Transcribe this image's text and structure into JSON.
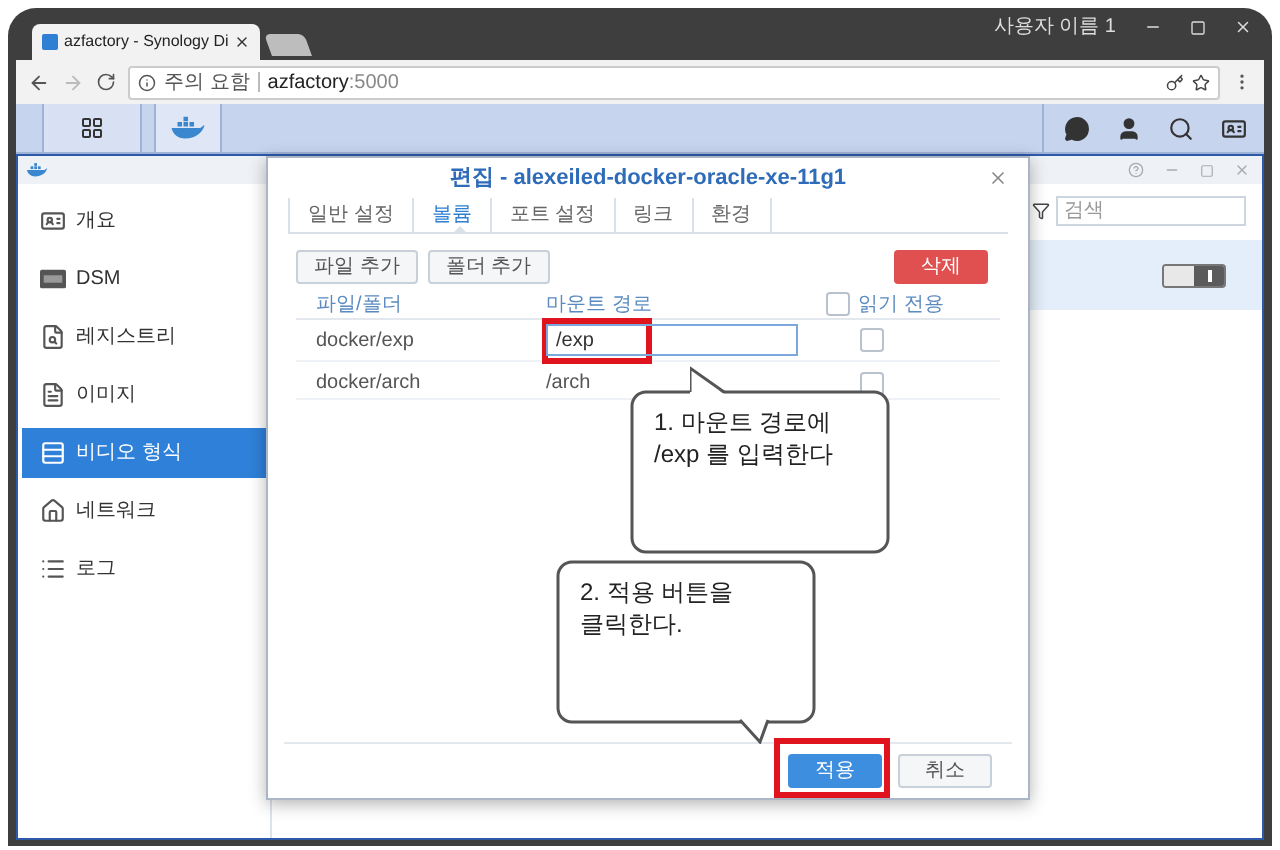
{
  "browser": {
    "tab_title": "azfactory - Synology Di",
    "profile": "사용자 이름 1",
    "security": "주의 요함",
    "url_host": "azfactory",
    "url_port": ":5000"
  },
  "sidebar": {
    "items": [
      {
        "label": "개요",
        "selected": false
      },
      {
        "label": "DSM",
        "selected": false
      },
      {
        "label": "레지스트리",
        "selected": false
      },
      {
        "label": "이미지",
        "selected": false
      },
      {
        "label": "비디오 형식",
        "selected": true
      },
      {
        "label": "네트워크",
        "selected": false
      },
      {
        "label": "로그",
        "selected": false
      }
    ]
  },
  "search": {
    "placeholder": "검색"
  },
  "container_row": {
    "on": true
  },
  "dialog": {
    "title": "편집 - alexeiled-docker-oracle-xe-11g1",
    "tabs": [
      {
        "label": "일반 설정",
        "selected": false
      },
      {
        "label": "볼륨",
        "selected": true
      },
      {
        "label": "포트 설정",
        "selected": false
      },
      {
        "label": "링크",
        "selected": false
      },
      {
        "label": "환경",
        "selected": false
      }
    ],
    "add_file": "파일 추가",
    "add_folder": "폴더 추가",
    "delete": "삭제",
    "columns": [
      "파일/폴더",
      "마운트 경로",
      "읽기 전용"
    ],
    "header_checked": false,
    "rows": [
      {
        "path": "docker/exp",
        "mount": "/exp",
        "editing": true,
        "read_only": false
      },
      {
        "path": "docker/arch",
        "mount": "/arch",
        "editing": false,
        "read_only": false
      }
    ],
    "apply": "적용",
    "cancel": "취소"
  },
  "annotations": [
    "1. 마운트 경로에\n/exp 를 입력한다",
    "2. 적용 버튼을\n클릭한다."
  ]
}
